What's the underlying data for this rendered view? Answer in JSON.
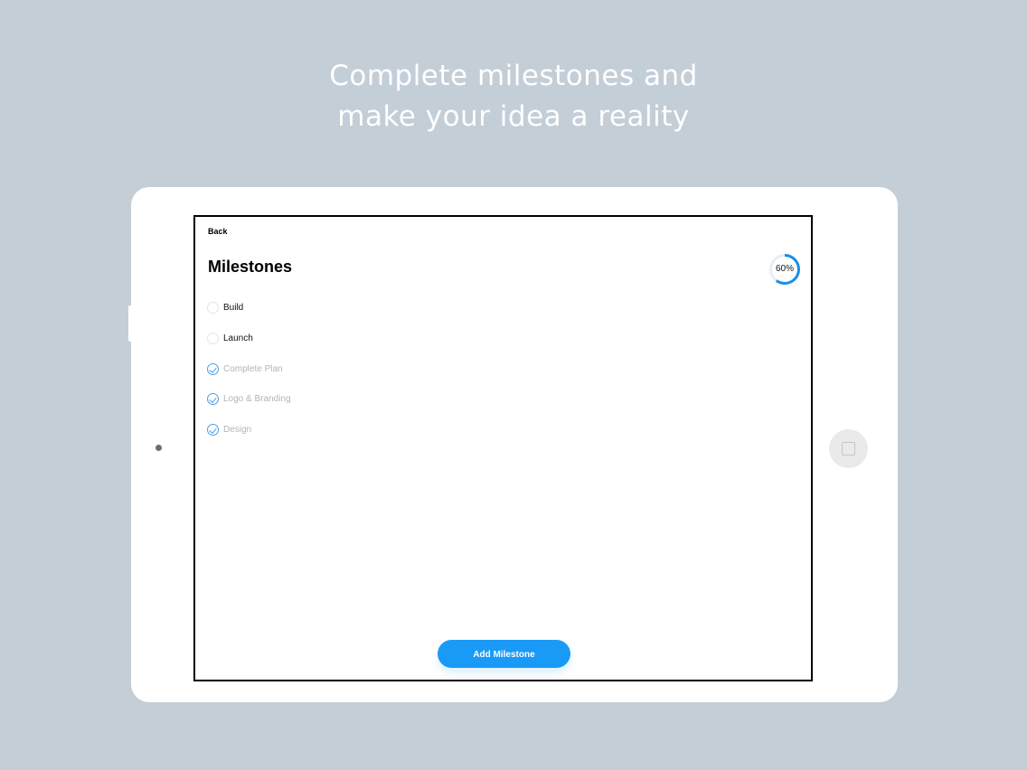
{
  "headline": {
    "line1": "Complete milestones and",
    "line2": "make your idea a reality"
  },
  "nav": {
    "back_label": "Back"
  },
  "page": {
    "title": "Milestones"
  },
  "progress": {
    "percent": 60,
    "label": "60%",
    "color": "#1a8ee8"
  },
  "milestones": [
    {
      "label": "Build",
      "done": false
    },
    {
      "label": "Launch",
      "done": false
    },
    {
      "label": "Complete Plan",
      "done": true
    },
    {
      "label": "Logo & Branding",
      "done": true
    },
    {
      "label": "Design",
      "done": true
    }
  ],
  "actions": {
    "add_label": "Add Milestone",
    "accent": "#1a9af7"
  },
  "icons": {
    "checkmark": "check-circle-icon",
    "empty": "empty-circle-icon",
    "home": "home-button-icon"
  }
}
